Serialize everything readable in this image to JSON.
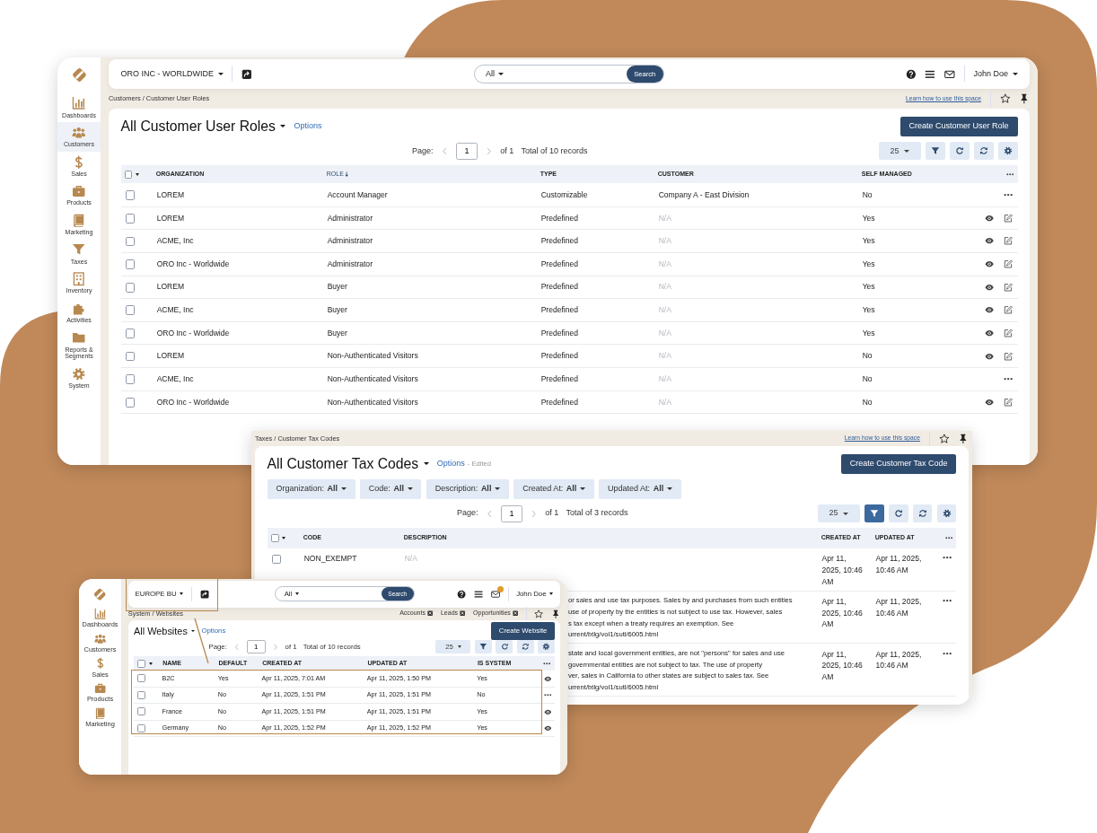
{
  "windows": [
    {
      "kind": "main",
      "sidebar": [
        {
          "label": "Dashboards",
          "selected": false
        },
        {
          "label": "Customers",
          "selected": true
        },
        {
          "label": "Sales",
          "selected": false
        },
        {
          "label": "Products",
          "selected": false
        },
        {
          "label": "Marketing",
          "selected": false
        },
        {
          "label": "Taxes",
          "selected": false
        },
        {
          "label": "Inventory",
          "selected": false
        },
        {
          "label": "Activities",
          "selected": false
        },
        {
          "label": "Reports & Segments",
          "selected": false
        },
        {
          "label": "System",
          "selected": false
        }
      ],
      "topbar": {
        "organization": "ORO INC - WORLDWIDE",
        "search_scope": "All",
        "search_button": "Search",
        "user": "John Doe"
      },
      "breadcrumb": "Customers / Customer User Roles",
      "help_link": "Learn how to use this space",
      "title": "All Customer User Roles",
      "options_link": "Options",
      "create_button": "Create Customer User Role",
      "pager": {
        "label": "Page:",
        "page": "1",
        "of": "of 1",
        "total": "Total of 10 records"
      },
      "page_size": "25",
      "filter_active": false,
      "table": {
        "all_checked": false,
        "columns": [
          {
            "label": "ORGANIZATION",
            "sorted": false
          },
          {
            "label": "ROLE",
            "sorted": true
          },
          {
            "label": "TYPE",
            "sorted": false
          },
          {
            "label": "CUSTOMER",
            "sorted": false
          },
          {
            "label": "SELF MANAGED",
            "sorted": false
          }
        ],
        "rows": [
          {
            "checked": false,
            "kind": "more",
            "cells": [
              "LOREM",
              "Account Manager",
              "Customizable",
              "Company A - East Division",
              "No"
            ]
          },
          {
            "checked": false,
            "kind": "edit",
            "cells": [
              "LOREM",
              "Administrator",
              "Predefined",
              {
                "text": "N/A",
                "muted": true
              },
              "Yes"
            ]
          },
          {
            "checked": false,
            "kind": "edit",
            "cells": [
              "ACME, Inc",
              "Administrator",
              "Predefined",
              {
                "text": "N/A",
                "muted": true
              },
              "Yes"
            ]
          },
          {
            "checked": false,
            "kind": "edit",
            "cells": [
              "ORO Inc - Worldwide",
              "Administrator",
              "Predefined",
              {
                "text": "N/A",
                "muted": true
              },
              "Yes"
            ]
          },
          {
            "checked": false,
            "kind": "edit",
            "cells": [
              "LOREM",
              "Buyer",
              "Predefined",
              {
                "text": "N/A",
                "muted": true
              },
              "Yes"
            ]
          },
          {
            "checked": false,
            "kind": "edit",
            "cells": [
              "ACME, Inc",
              "Buyer",
              "Predefined",
              {
                "text": "N/A",
                "muted": true
              },
              "Yes"
            ]
          },
          {
            "checked": false,
            "kind": "edit",
            "cells": [
              "ORO Inc - Worldwide",
              "Buyer",
              "Predefined",
              {
                "text": "N/A",
                "muted": true
              },
              "Yes"
            ]
          },
          {
            "checked": false,
            "kind": "edit",
            "cells": [
              "LOREM",
              "Non-Authenticated Visitors",
              "Predefined",
              {
                "text": "N/A",
                "muted": true
              },
              "No"
            ]
          },
          {
            "checked": false,
            "kind": "more",
            "cells": [
              "ACME, Inc",
              "Non-Authenticated Visitors",
              "Predefined",
              {
                "text": "N/A",
                "muted": true
              },
              "No"
            ]
          },
          {
            "checked": false,
            "kind": "edit",
            "cells": [
              "ORO Inc - Worldwide",
              "Non-Authenticated Visitors",
              "Predefined",
              {
                "text": "N/A",
                "muted": true
              },
              "No"
            ]
          }
        ]
      }
    },
    {
      "kind": "overlay",
      "breadcrumb": "Taxes / Customer Tax Codes",
      "help_link": "Learn how to use this space",
      "title": "All Customer Tax Codes",
      "options_link": "Options",
      "edited_note": "- Edited",
      "create_button": "Create Customer Tax Code",
      "filters": [
        {
          "label": "Organization:",
          "value": "All"
        },
        {
          "label": "Code:",
          "value": "All"
        },
        {
          "label": "Description:",
          "value": "All"
        },
        {
          "label": "Created At:",
          "value": "All"
        },
        {
          "label": "Updated At:",
          "value": "All"
        }
      ],
      "pager": {
        "label": "Page:",
        "page": "1",
        "of": "of 1",
        "total": "Total of 3 records"
      },
      "page_size": "25",
      "filter_active": true,
      "table": {
        "all_checked": false,
        "columns": [
          {
            "label": "CODE"
          },
          {
            "label": "DESCRIPTION"
          },
          {
            "label": "CREATED AT"
          },
          {
            "label": "UPDATED AT"
          }
        ],
        "rows": [
          {
            "checked": false,
            "kind": "more",
            "cells": [
              "NON_EXEMPT",
              {
                "text": "N/A",
                "muted": true
              },
              "Apr 11, 2025, 10:46 AM",
              "Apr 11, 2025, 10:46 AM"
            ]
          },
          {
            "covered": true,
            "kind": "more",
            "cells": [
              {
                "lines": [
                  "or sales and use tax purposes. Sales by and purchases from such entities",
                  "use of property by the entities is not subject to use tax. However, sales",
                  "s tax except when a treaty requires an exemption. See",
                  "urrent/btlg/vol1/sutl/6005.html"
                ]
              },
              "Apr 11, 2025, 10:46 AM",
              "Apr 11, 2025, 10:46 AM"
            ]
          },
          {
            "covered": true,
            "kind": "more",
            "cells": [
              {
                "lines": [
                  "state and local government entities, are not \"persons\" for sales and use",
                  "governmental entities are not subject to tax. The use of property",
                  "ver, sales in California to other states are subject to sales tax. See",
                  "urrent/btlg/vol1/sutl/6005.html"
                ]
              },
              "Apr 11, 2025, 10:46 AM",
              "Apr 11, 2025, 10:46 AM"
            ]
          }
        ]
      }
    },
    {
      "kind": "inset",
      "sidebar": [
        {
          "label": "Dashboards",
          "selected": false
        },
        {
          "label": "Customers",
          "selected": false
        },
        {
          "label": "Sales",
          "selected": false
        },
        {
          "label": "Products",
          "selected": false
        },
        {
          "label": "Marketing",
          "selected": false
        }
      ],
      "topbar": {
        "organization": "EUROPE BU",
        "search_scope": "All",
        "search_button": "Search",
        "user": "John Doe",
        "notifications": true
      },
      "breadcrumb": "System / Websites",
      "pinned_tabs": [
        "Accounts",
        "Leads",
        "Opportunities"
      ],
      "title": "All Websites",
      "options_link": "Options",
      "create_button": "Create Website",
      "pager": {
        "label": "Page:",
        "page": "1",
        "of": "of 1",
        "total": "Total of 10 records"
      },
      "page_size": "25",
      "filter_active": false,
      "table": {
        "all_checked": false,
        "columns": [
          {
            "label": "NAME"
          },
          {
            "label": "DEFAULT"
          },
          {
            "label": "CREATED AT"
          },
          {
            "label": "UPDATED AT"
          },
          {
            "label": "IS SYSTEM"
          }
        ],
        "rows": [
          {
            "checked": false,
            "kind": "view",
            "cells": [
              "B2C",
              "Yes",
              "Apr 11, 2025, 7:01 AM",
              "Apr 11, 2025, 1:50 PM",
              "Yes"
            ]
          },
          {
            "checked": false,
            "kind": "more",
            "cells": [
              "Italy",
              "No",
              "Apr 11, 2025, 1:51 PM",
              "Apr 11, 2025, 1:51 PM",
              "No"
            ]
          },
          {
            "checked": false,
            "kind": "view",
            "cells": [
              "France",
              "No",
              "Apr 11, 2025, 1:51 PM",
              "Apr 11, 2025, 1:51 PM",
              "Yes"
            ]
          },
          {
            "checked": false,
            "kind": "view",
            "cells": [
              "Germany",
              "No",
              "Apr 11, 2025, 1:52 PM",
              "Apr 11, 2025, 1:52 PM",
              "Yes"
            ]
          }
        ]
      }
    }
  ]
}
